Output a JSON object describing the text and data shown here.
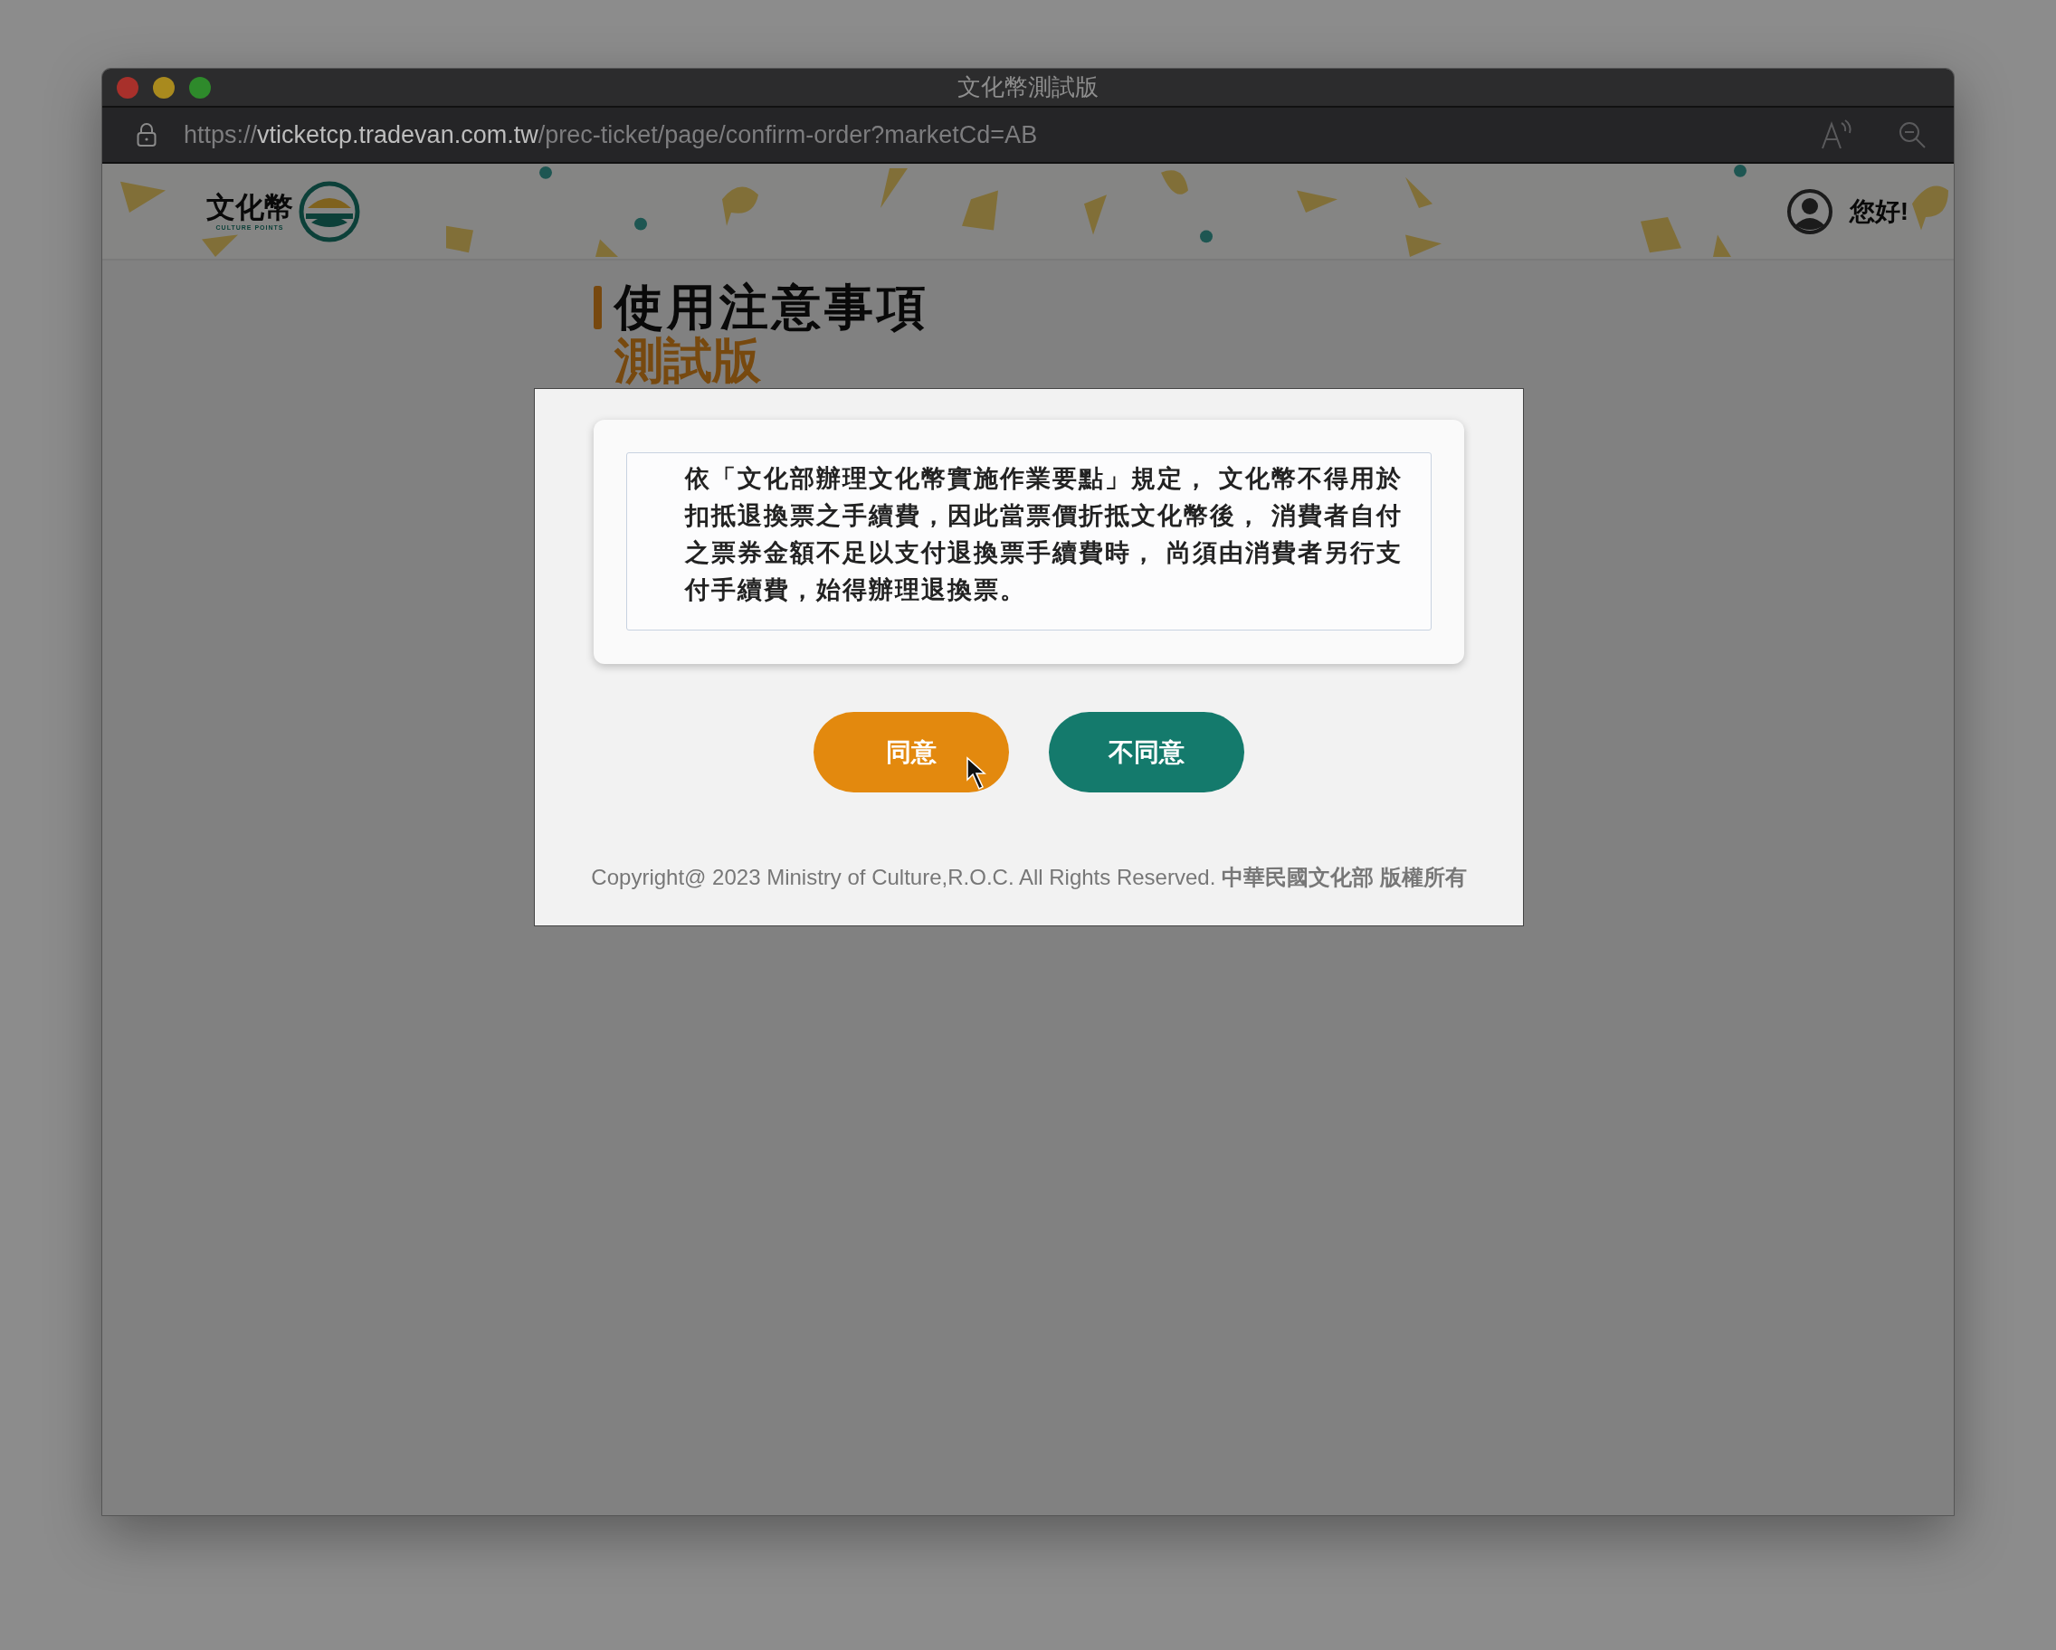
{
  "window": {
    "title": "文化幣測試版"
  },
  "address_bar": {
    "scheme": "https://",
    "host": "vticketcp.tradevan.com.tw",
    "path": "/prec-ticket/page/confirm-order?marketCd=AB"
  },
  "header": {
    "logo_text": "文化幣",
    "logo_subtitle": "CULTURE POINTS",
    "greeting": "您好!"
  },
  "page": {
    "title": "使用注意事項",
    "subtitle": "測試版"
  },
  "dialog": {
    "notice": "依「文化部辦理文化幣實施作業要點」規定， 文化幣不得用於扣抵退換票之手續費，因此當票價折抵文化幣後， 消費者自付之票券金額不足以支付退換票手續費時， 尚須由消費者另行支付手續費，始得辦理退換票。",
    "buttons": [
      {
        "label": "同意",
        "kind": "primary"
      },
      {
        "label": "不同意",
        "kind": "secondary"
      }
    ],
    "footer": "Copyright@ 2023 Ministry of Culture,R.O.C. All Rights Reserved. **中華民國文化部 版權所有**"
  }
}
